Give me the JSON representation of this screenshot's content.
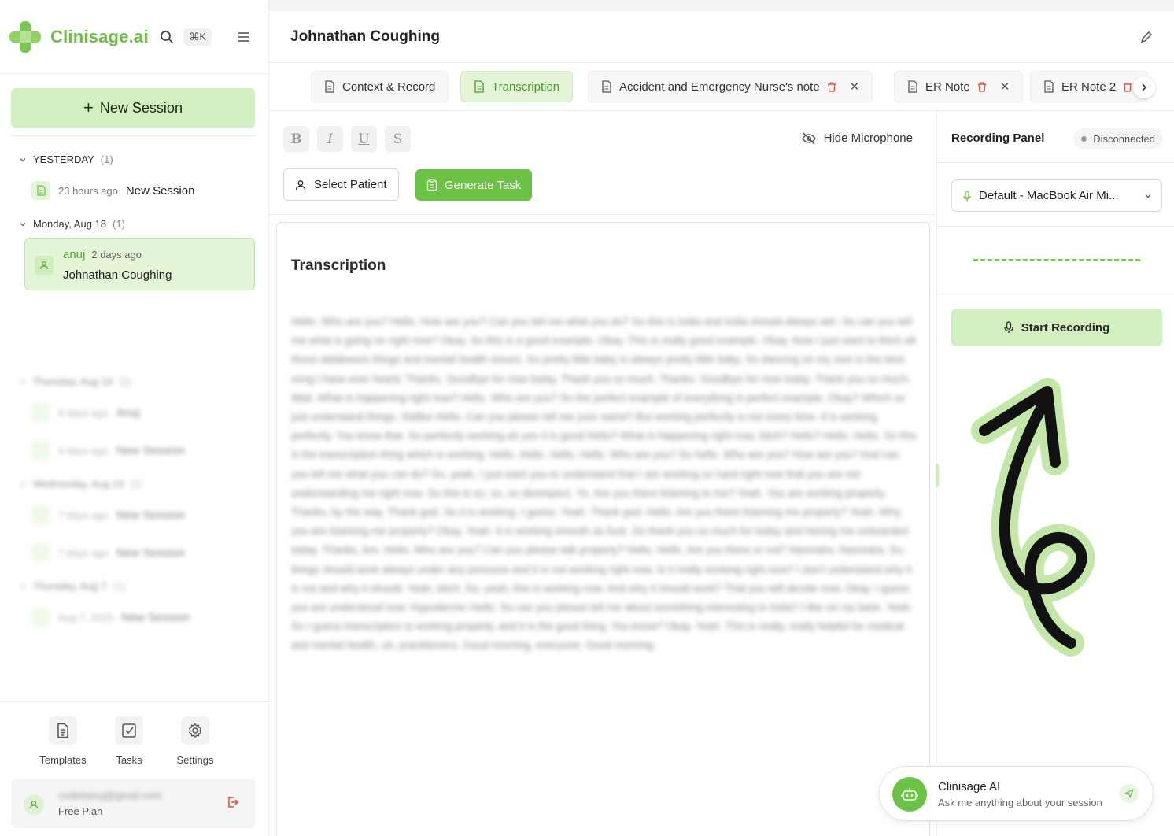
{
  "brand": {
    "name": "Clinisage.ai",
    "accent": "#6cc246",
    "accent_light": "#d2efbf"
  },
  "header": {
    "shortcut": "⌘K"
  },
  "sidebar": {
    "new_session_label": "New Session",
    "groups": [
      {
        "label": "YESTERDAY",
        "count": "(1)",
        "sessions": [
          {
            "time": "23 hours ago",
            "title": "New Session"
          }
        ]
      },
      {
        "label": "Monday, Aug 18",
        "count": "(1)",
        "sessions": [
          {
            "user": "anuj",
            "time": "2 days ago",
            "title": "Johnathan Coughing",
            "active": true
          }
        ]
      },
      {
        "label": "Thursday, Aug 14",
        "count": "(2)",
        "sessions": [
          {
            "time": "6 days ago",
            "title": "Anuj"
          },
          {
            "time": "6 days ago",
            "title": "New Session"
          }
        ]
      },
      {
        "label": "Wednesday, Aug 13",
        "count": "(2)",
        "sessions": [
          {
            "time": "7 days ago",
            "title": "New Session"
          },
          {
            "time": "7 days ago",
            "title": "New Session"
          }
        ]
      },
      {
        "label": "Thursday, Aug 7",
        "count": "(1)",
        "sessions": [
          {
            "time": "Aug 7, 2025",
            "title": "New Session"
          }
        ]
      }
    ],
    "footer_nav": [
      {
        "label": "Templates",
        "icon": "document-icon"
      },
      {
        "label": "Tasks",
        "icon": "checkbox-icon"
      },
      {
        "label": "Settings",
        "icon": "gear-icon"
      }
    ],
    "user": {
      "email": "codeitanuj@gmail.com",
      "plan": "Free Plan"
    }
  },
  "main": {
    "title": "Johnathan Coughing",
    "tabs": [
      {
        "label": "Context & Record"
      },
      {
        "label": "Transcription",
        "active": true
      },
      {
        "label": "Accident and Emergency Nurse's note"
      },
      {
        "label": "ER Note"
      },
      {
        "label": "ER Note 2"
      }
    ],
    "toolbar": {
      "bold": "B",
      "italic": "I",
      "underline": "U",
      "strike": "S",
      "hide_mic": "Hide Microphone",
      "select_patient": "Select Patient",
      "generate_task": "Generate Task"
    },
    "document": {
      "title": "Transcription",
      "body": "Hello. Who are you? Hello. How are you? Can you tell me what you do? So this is India and India should always win. So can you tell me what is going on right now? Okay. So this is a good example. Okay. This is really good example. Okay. Now I just want to fetch all those databases things and mental health issues. So pretty little baby is always pretty little baby. So dancing on my own is the best song I have ever heard. Thanks. Goodbye for now today. Thank you so much. Thanks. Goodbye for now today. Thank you so much. Wait. What is happening right now? Hello. Who are you? So the perfect example of everything is perfect example. Okay? Which so just understand things. Xlaflex Hello. Can you please tell me your name? But working perfectly is not every time. It is working perfectly. You know that. So perfectly working ah yes it is good Hello? What is happening right now, bitch? Hello? Hello. Hello. So this is the transcription thing which is working. Hello. Hello. Hello. Hello. Who are you? So hello. Who are you? How are you? And can you tell me what you can do? So, yeah, I just want you to understand that I am working so hard right now that you are not understanding me right now. So this is so, so, so disrespect. Yo. Are you there listening to me? Yeah. You are working properly. Thanks, by the way. Thank god. So it is working, I guess. Yeah. Thank god. Hello. Are you there listening me properly? Yeah. Why you are listening me properly? Okay. Yeah. It is working smooth as fuck. So thank you so much for today and having me onboarded today. Thanks, bro. Hello. Who are you? Can you please talk properly? Hello. Hello. Are you there or not? Narendra. Narendra. So, things should work always under any pressure and it is not working right now. Is it really working right now? I don't understand why it is not and why it should. Yeah, bitch. So, yeah, this is working now. And why it should work? That you will decide now. Okay. I guess you are understood now. Hypodermic Hello. So can you please tell me about something interesting in India? I like on my back. Yeah. So I guess transcription is working properly, and it is the good thing. You know? Okay. Yeah. This is really, really helpful for medical and mental health, uh, practitioners. Good morning, everyone. Good morning."
    }
  },
  "recording": {
    "title": "Recording Panel",
    "status": "Disconnected",
    "device": "Default - MacBook Air Mi...",
    "start_label": "Start Recording"
  },
  "assistant": {
    "title": "Clinisage AI",
    "subtitle": "Ask me anything about your session"
  }
}
